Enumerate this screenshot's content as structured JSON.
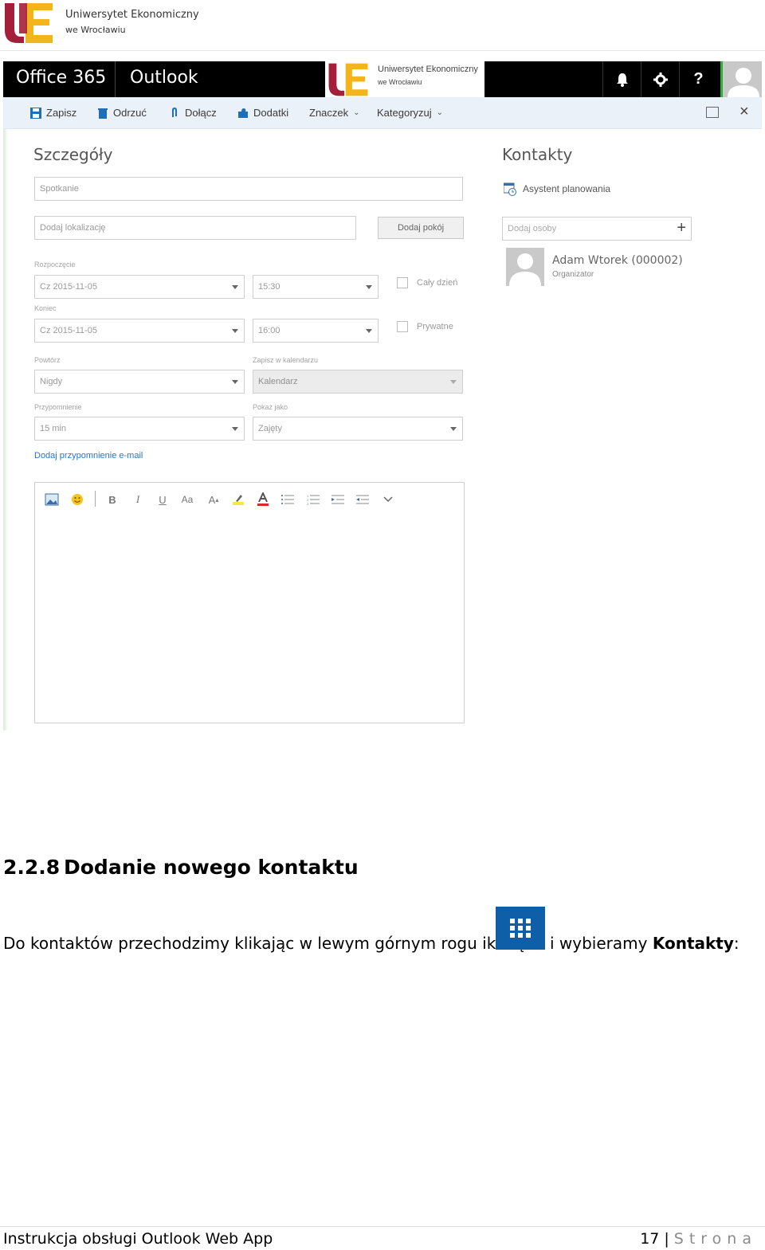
{
  "doc_header": {
    "logo_letters": "UE",
    "university_name": "Uniwersytet Ekonomiczny",
    "university_city": "we Wrocławiu"
  },
  "owa": {
    "suite_brand": "Office 365",
    "app_name": "Outlook",
    "org_name": "Uniwersytet Ekonomiczny",
    "org_city": "we Wrocławiu",
    "suite_icons": [
      "bell-icon",
      "gear-icon",
      "help-icon",
      "user-avatar"
    ],
    "toolbar": {
      "save": "Zapisz",
      "discard": "Odrzuć",
      "attach": "Dołącz",
      "addins": "Dodatki",
      "flag": "Znaczek",
      "categorize": "Kategoryzuj"
    },
    "details": {
      "title": "Szczegóły",
      "subject_value": "Spotkanie",
      "location_placeholder": "Dodaj lokalizację",
      "add_room": "Dodaj pokój",
      "start_label": "Rozpoczęcie",
      "start_date": "Cz 2015-11-05",
      "start_time": "15:30",
      "all_day": "Cały dzień",
      "end_label": "Koniec",
      "end_date": "Cz 2015-11-05",
      "end_time": "16:00",
      "private": "Prywatne",
      "repeat_label": "Powtórz",
      "repeat_value": "Nigdy",
      "save_to_label": "Zapisz w kalendarzu",
      "save_to_value": "Kalendarz",
      "reminder_label": "Przypomnienie",
      "reminder_value": "15 min",
      "show_as_label": "Pokaż jako",
      "show_as_value": "Zajęty",
      "add_email_reminder": "Dodaj przypomnienie e-mail",
      "editor_tools": {
        "bold": "B",
        "italic": "I",
        "underline": "U",
        "font_size": "Aa",
        "grow": "A"
      }
    },
    "contacts": {
      "title": "Kontakty",
      "scheduling_assistant": "Asystent planowania",
      "people_placeholder": "Dodaj osoby",
      "attendee_name": "Adam Wtorek (000002)",
      "attendee_role": "Organizator"
    }
  },
  "section": {
    "number": "2.2.8",
    "title": "Dodanie nowego kontaktu",
    "para_before_icon": "Do kontaktów przechodzimy klikając w lewym górnym rogu ikonę",
    "para_after_icon_prefix": "i wybieramy ",
    "para_after_icon_bold": "Kontakty",
    "para_after_icon_suffix": ":"
  },
  "footer": {
    "title": "Instrukcja obsługi Outlook Web App",
    "page_number": "17",
    "separator": "|",
    "page_word": "Strona"
  },
  "colors": {
    "ue_red": "#a4203a",
    "ue_yellow": "#f3b51b",
    "apps_tile_blue": "#0f5ea8",
    "link_blue": "#2b74c4",
    "presence_green": "#2eae3c"
  }
}
